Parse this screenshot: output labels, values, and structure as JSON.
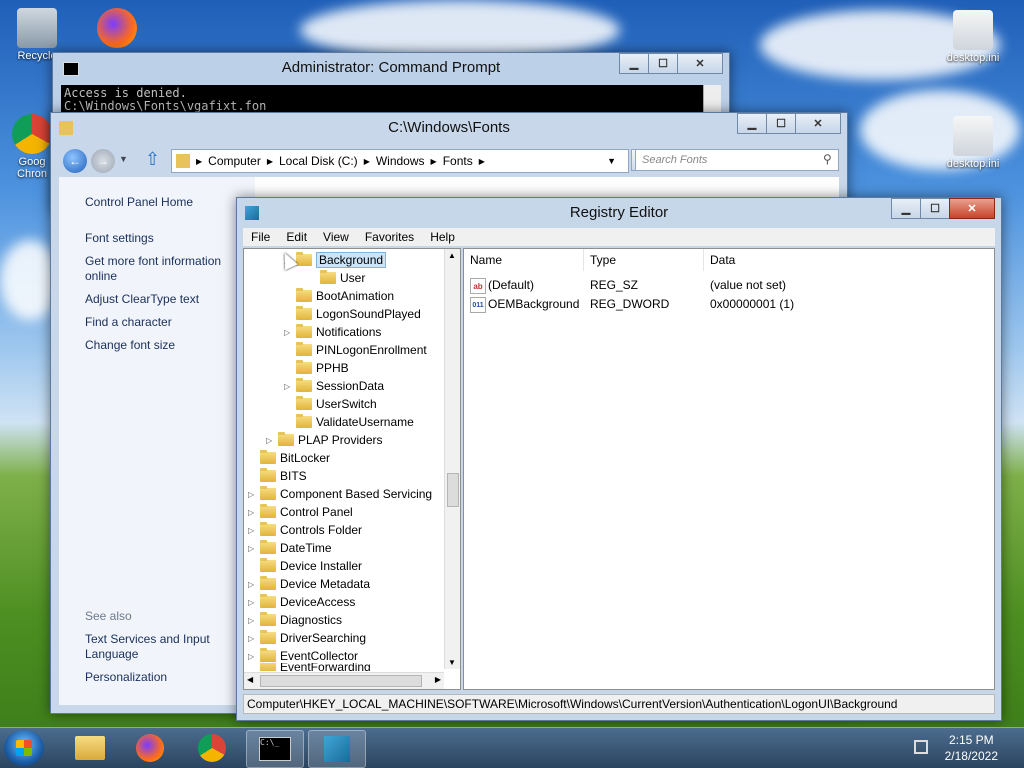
{
  "desktop": {
    "icons": [
      {
        "label": "Recycle"
      },
      {
        "label": "Goog Chron"
      },
      {
        "label": "desktop.ini"
      },
      {
        "label": "desktop.ini"
      }
    ]
  },
  "cmd": {
    "title": "Administrator: Command Prompt",
    "lines": [
      "Access is denied.",
      "C:\\Windows\\Fonts\\vgafixt.fon"
    ]
  },
  "explorer": {
    "title": "C:\\Windows\\Fonts",
    "breadcrumb": [
      "Computer",
      "Local Disk (C:)",
      "Windows",
      "Fonts"
    ],
    "search_placeholder": "Search Fonts",
    "sidebar": {
      "home": "Control Panel Home",
      "links": [
        "Font settings",
        "Get more font information online",
        "Adjust ClearType text",
        "Find a character",
        "Change font size"
      ],
      "see_also_label": "See also",
      "see_also": [
        "Text Services and Input Language",
        "Personalization"
      ]
    }
  },
  "regedit": {
    "title": "Registry Editor",
    "menu": [
      "File",
      "Edit",
      "View",
      "Favorites",
      "Help"
    ],
    "tree": [
      {
        "label": "Background",
        "selected": true
      },
      {
        "label": "User"
      },
      {
        "label": "BootAnimation"
      },
      {
        "label": "LogonSoundPlayed"
      },
      {
        "label": "Notifications"
      },
      {
        "label": "PINLogonEnrollment"
      },
      {
        "label": "PPHB"
      },
      {
        "label": "SessionData"
      },
      {
        "label": "UserSwitch"
      },
      {
        "label": "ValidateUsername"
      },
      {
        "label": "PLAP Providers"
      },
      {
        "label": "BitLocker"
      },
      {
        "label": "BITS"
      },
      {
        "label": "Component Based Servicing"
      },
      {
        "label": "Control Panel"
      },
      {
        "label": "Controls Folder"
      },
      {
        "label": "DateTime"
      },
      {
        "label": "Device Installer"
      },
      {
        "label": "Device Metadata"
      },
      {
        "label": "DeviceAccess"
      },
      {
        "label": "Diagnostics"
      },
      {
        "label": "DriverSearching"
      },
      {
        "label": "EventCollector"
      },
      {
        "label": "EventForwarding"
      }
    ],
    "columns": [
      "Name",
      "Type",
      "Data"
    ],
    "values": [
      {
        "icon": "ab",
        "name": "(Default)",
        "type": "REG_SZ",
        "data": "(value not set)"
      },
      {
        "icon": "011",
        "name": "OEMBackground",
        "type": "REG_DWORD",
        "data": "0x00000001 (1)"
      }
    ],
    "status": "Computer\\HKEY_LOCAL_MACHINE\\SOFTWARE\\Microsoft\\Windows\\CurrentVersion\\Authentication\\LogonUI\\Background"
  },
  "taskbar": {
    "time": "2:15 PM",
    "date": "2/18/2022"
  }
}
